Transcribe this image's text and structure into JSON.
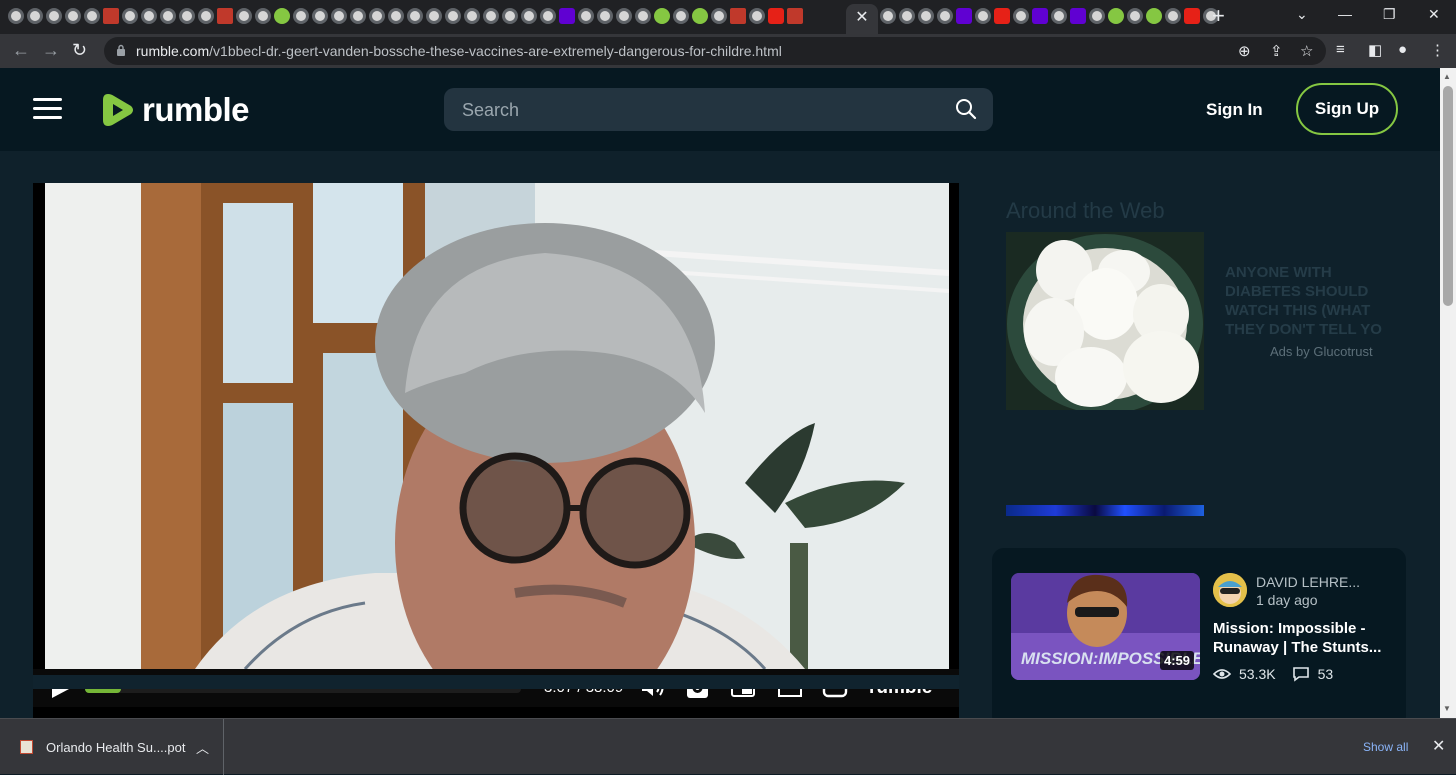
{
  "browser": {
    "active_tab_close": "✕",
    "new_tab": "+",
    "url_host": "rumble.com",
    "url_path": "/v1bbecl-dr.-geert-vanden-bossche-these-vaccines-are-extremely-dangerous-for-childre.html"
  },
  "header": {
    "logo_text": "rumble",
    "search_placeholder": "Search",
    "sign_in": "Sign In",
    "sign_up": "Sign Up"
  },
  "player": {
    "time": "3:07 / 38:09",
    "progress": 0.082,
    "logo": "rumble"
  },
  "sidebar": {
    "ad_title": "Around the Web",
    "ad_headline": "ANYONE WITH DIABETES SHOULD WATCH THIS (WHAT THEY DON'T TELL YO",
    "ad_by": "Ads by Glucotrust",
    "related": {
      "channel": "DAVID LEHRE...",
      "ago": "1 day ago",
      "title": "Mission: Impossible - Runaway | The Stunts...",
      "duration": "4:59",
      "views": "53.3K",
      "comments": "53",
      "thumb_text": "MISSION:IMPOSSIBLE"
    }
  },
  "downloads": {
    "file": "Orlando Health Su....pot",
    "show_all": "Show all"
  },
  "colors": {
    "brand_green": "#85c742",
    "header_bg": "#061821",
    "page_bg": "#0f212b"
  }
}
